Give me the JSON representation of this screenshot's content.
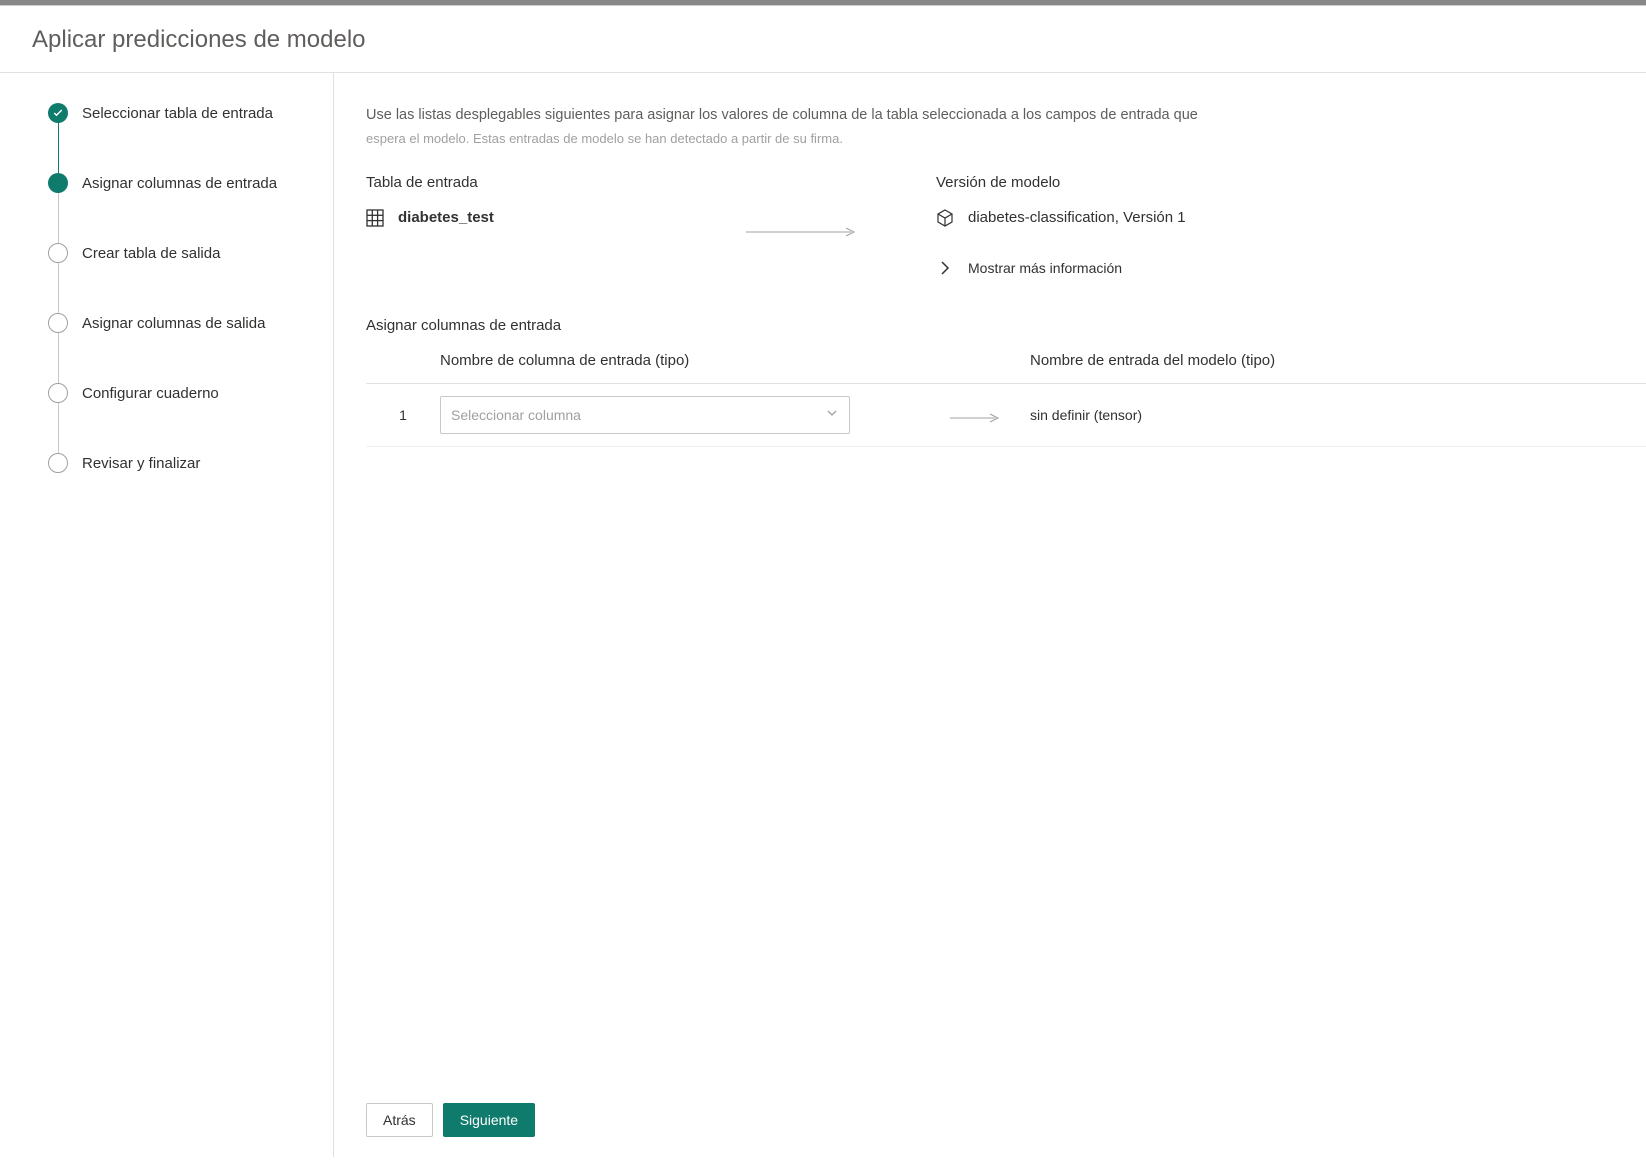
{
  "dialog": {
    "title": "Aplicar predicciones de modelo"
  },
  "steps": {
    "s1": "Seleccionar tabla de entrada",
    "s2": "Asignar columnas de entrada",
    "s3": "Crear tabla de salida",
    "s4": "Asignar columnas de salida",
    "s5": "Configurar cuaderno",
    "s6": "Revisar y finalizar"
  },
  "main": {
    "description": "Use las listas desplegables siguientes para asignar los valores de columna de la tabla seleccionada a los campos de entrada que",
    "description_sub": "espera el modelo. Estas entradas de modelo se han detectado a partir de su firma.",
    "input_table_label": "Tabla de entrada",
    "input_table_value": "diabetes_test",
    "model_version_label": "Versión de modelo",
    "model_version_value": "diabetes-classification, Versión 1",
    "show_more": "Mostrar más información",
    "mapping_title": "Asignar columnas de entrada",
    "col_header_input": "Nombre de columna de entrada (tipo)",
    "col_header_model": "Nombre de entrada del modelo (tipo)",
    "rows": [
      {
        "num": "1",
        "select_placeholder": "Seleccionar columna",
        "model_input": "sin definir (tensor)"
      }
    ]
  },
  "footer": {
    "back": "Atrás",
    "next": "Siguiente"
  }
}
